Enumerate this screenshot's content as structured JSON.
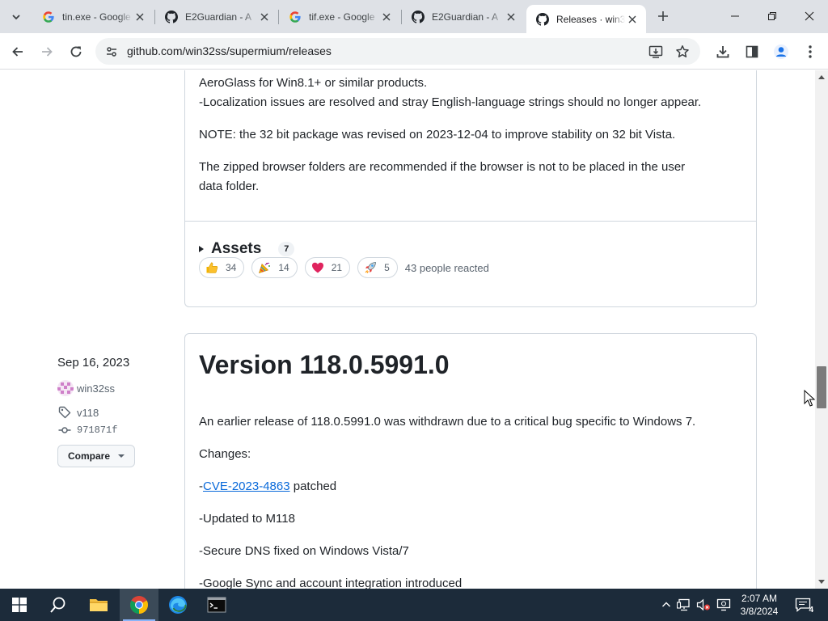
{
  "browser": {
    "tabs": [
      {
        "title": "tin.exe - Google",
        "favicon": "google-g-icon",
        "active": false
      },
      {
        "title": "E2Guardian - A",
        "favicon": "github-icon",
        "active": false
      },
      {
        "title": "tif.exe - Google",
        "favicon": "google-g-icon",
        "active": false
      },
      {
        "title": "E2Guardian - A",
        "favicon": "github-icon",
        "active": false
      },
      {
        "title": "Releases · win3",
        "favicon": "github-icon",
        "active": true
      }
    ],
    "url": "github.com/win32ss/supermium/releases"
  },
  "release_prev": {
    "lines": [
      "AeroGlass for Win8.1+ or similar products.",
      "-Localization issues are resolved and stray English-language strings should no longer appear.",
      "NOTE: the 32 bit package was revised on 2023-12-04 to improve stability on 32 bit Vista.",
      "The zipped browser folders are recommended if the browser is not to be placed in the user",
      "data folder."
    ],
    "assets_label": "Assets",
    "assets_count": "7",
    "reactions": [
      {
        "emoji": "thumbs-up-icon",
        "count": "34"
      },
      {
        "emoji": "party-popper-icon",
        "count": "14"
      },
      {
        "emoji": "heart-icon",
        "count": "21"
      },
      {
        "emoji": "rocket-icon",
        "count": "5"
      }
    ],
    "reacted_text": "43 people reacted"
  },
  "release": {
    "date": "Sep 16, 2023",
    "author": "win32ss",
    "tag": "v118",
    "commit": "971871f",
    "compare_label": "Compare",
    "title": "Version 118.0.5991.0",
    "intro": "An earlier release of 118.0.5991.0 was withdrawn due to a critical bug specific to Windows 7.",
    "changes_label": "Changes:",
    "cve_prefix": "-",
    "cve_link": "CVE-2023-4863",
    "cve_suffix": " patched",
    "items": [
      "-Updated to M118",
      "-Secure DNS fixed on Windows Vista/7",
      "-Google Sync and account integration introduced"
    ]
  },
  "taskbar": {
    "time": "2:07 AM",
    "date": "3/8/2024",
    "notification_count": "4"
  }
}
